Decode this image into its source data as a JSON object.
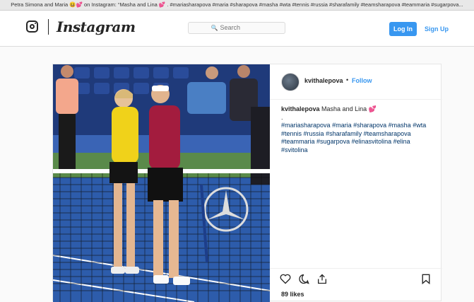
{
  "window": {
    "title": "Petra Simona and Maria 😆💕 on Instagram: “Masha and Lina 💕 . #mariasharapova #maria #sharapova #masha #wta #tennis #russia #sharafamily #teamsharapova #teammaria #sugarpova..."
  },
  "nav": {
    "brand": "Instagram",
    "search_placeholder": "Search",
    "login_label": "Log In",
    "signup_label": "Sign Up"
  },
  "post": {
    "username": "kvithalepova",
    "follow_label": "Follow",
    "caption_user": "kvithalepova",
    "caption_text": "Masha and Lina 💕",
    "caption_dot": ".",
    "hashtags": [
      "#mariasharapova",
      "#maria",
      "#sharapova",
      "#masha",
      "#wta",
      "#tennis",
      "#russia",
      "#sharafamily",
      "#teamsharapova",
      "#teammaria",
      "#sugarpova",
      "#elinasvitolina",
      "#elina",
      "#svitolina"
    ],
    "likes": "89 likes"
  },
  "colors": {
    "accent": "#3897f0",
    "court": "#2d5cab",
    "border": "#dbdbdb"
  },
  "icons": [
    "instagram-glyph-icon",
    "search-icon",
    "heart-icon",
    "comment-icon",
    "share-icon",
    "bookmark-icon"
  ]
}
